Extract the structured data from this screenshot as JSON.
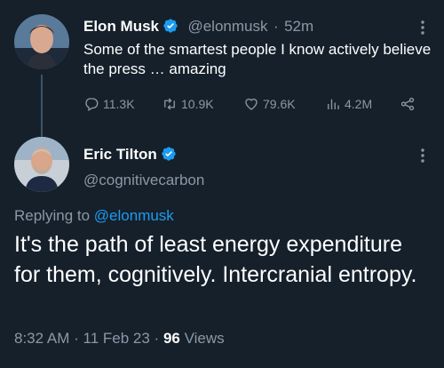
{
  "tweet1": {
    "author_name": "Elon Musk",
    "handle": "@elonmusk",
    "separator": "·",
    "time_ago": "52m",
    "text": "Some of the smartest people I know actively believe the press … amazing",
    "replies": "11.3K",
    "retweets": "10.9K",
    "likes": "79.6K",
    "views": "4.2M"
  },
  "tweet2": {
    "author_name": "Eric Tilton",
    "handle": "@cognitivecarbon",
    "replying_prefix": "Replying to",
    "replying_to": "@elonmusk",
    "text": "It's the path of least energy expenditure for them, cognitively. Intercranial entropy.",
    "time": "8:32 AM",
    "date": "11 Feb 23",
    "separator": "·",
    "views_count": "96",
    "views_label": "Views"
  },
  "colors": {
    "background": "#15202b",
    "accent": "#1d9bf0",
    "muted": "#8b98a5"
  },
  "icons": [
    "verified-badge-icon",
    "more-icon",
    "reply-icon",
    "retweet-icon",
    "like-icon",
    "views-icon",
    "share-icon"
  ]
}
